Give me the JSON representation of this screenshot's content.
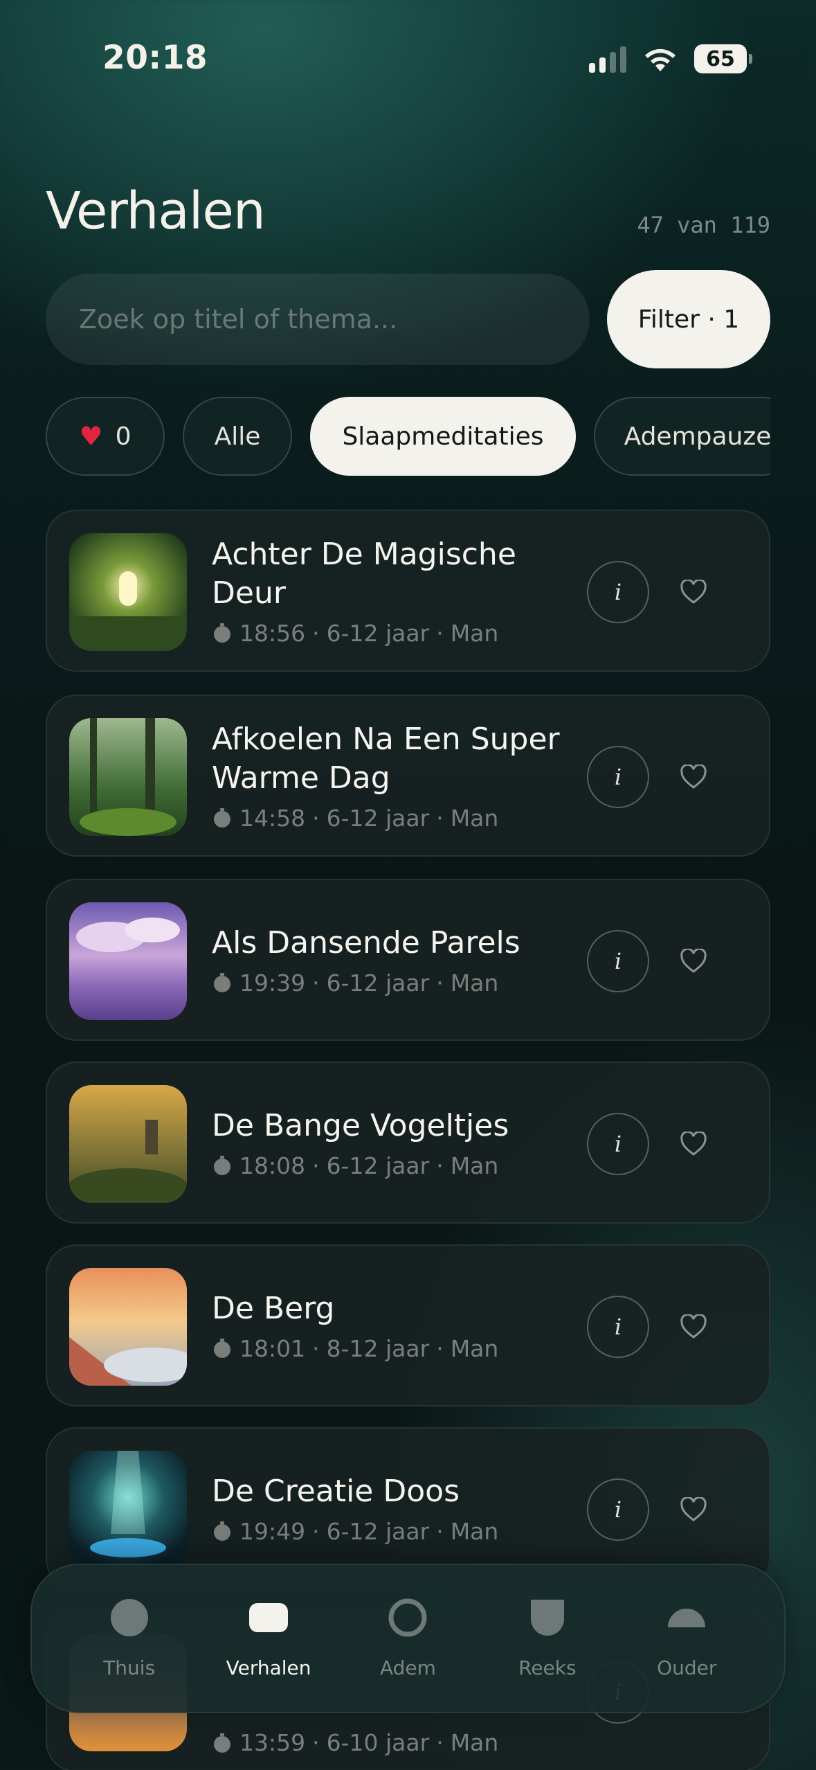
{
  "status_bar": {
    "time": "20:18",
    "battery": "65"
  },
  "header": {
    "title": "Verhalen",
    "count": "47 van 119"
  },
  "search": {
    "placeholder": "Zoek op titel of thema..."
  },
  "filter_button": {
    "label": "Filter · 1"
  },
  "chips": [
    {
      "label": "0",
      "icon": "heart-icon",
      "active": false
    },
    {
      "label": "Alle",
      "active": false
    },
    {
      "label": "Slaapmeditaties",
      "active": true
    },
    {
      "label": "Adempauze",
      "active": false
    }
  ],
  "stories": [
    {
      "title": "Achter De Magische Deur",
      "duration": "18:56",
      "age": "6-12 jaar",
      "voice": "Man"
    },
    {
      "title": "Afkoelen Na Een Super Warme Dag",
      "duration": "14:58",
      "age": "6-12 jaar",
      "voice": "Man"
    },
    {
      "title": "Als Dansende Parels",
      "duration": "19:39",
      "age": "6-12 jaar",
      "voice": "Man"
    },
    {
      "title": "De Bange Vogeltjes",
      "duration": "18:08",
      "age": "6-12 jaar",
      "voice": "Man"
    },
    {
      "title": "De Berg",
      "duration": "18:01",
      "age": "8-12 jaar",
      "voice": "Man"
    },
    {
      "title": "De Creatie Doos",
      "duration": "19:49",
      "age": "6-12 jaar",
      "voice": "Man"
    },
    {
      "title": "",
      "duration": "13:59",
      "age": "6-10 jaar",
      "voice": "Man"
    }
  ],
  "nav": [
    {
      "label": "Thuis",
      "icon": "home-icon"
    },
    {
      "label": "Verhalen",
      "icon": "stories-icon",
      "active": true
    },
    {
      "label": "Adem",
      "icon": "breath-icon"
    },
    {
      "label": "Reeks",
      "icon": "series-icon"
    },
    {
      "label": "Ouder",
      "icon": "parent-icon"
    }
  ],
  "colors": {
    "accent_light": "#f4f2ec",
    "heart_red": "#e0263e",
    "background": "#0a1717"
  }
}
